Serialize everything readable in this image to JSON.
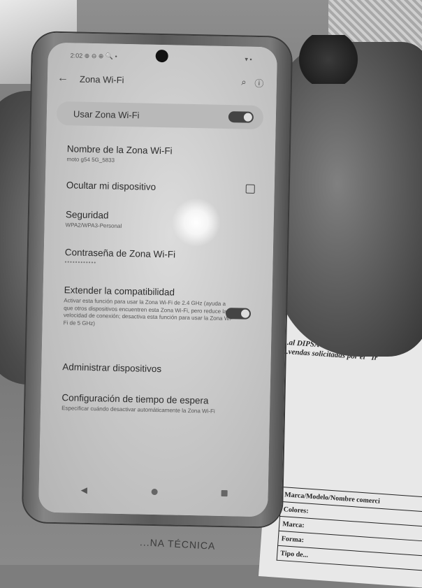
{
  "status_bar": {
    "time": "2:02",
    "indicators": "⊕ ⊖ ⊕ 🔍 •",
    "signal": "▾ ▪"
  },
  "header": {
    "title": "Zona Wi-Fi",
    "back_icon": "arrow-left-icon",
    "search_icon": "search-icon",
    "help_icon": "help-icon"
  },
  "master_switch": {
    "label": "Usar Zona Wi-Fi",
    "on": true
  },
  "settings": [
    {
      "title": "Nombre de la Zona Wi-Fi",
      "subtitle": "moto g54 5G_5833"
    },
    {
      "title": "Ocultar mi dispositivo",
      "checked": false
    },
    {
      "title": "Seguridad",
      "subtitle": "WPA2/WPA3-Personal"
    },
    {
      "title": "Contraseña de Zona Wi-Fi",
      "subtitle": "••••••••••••"
    },
    {
      "title": "Extender la compatibilidad",
      "subtitle": "Activar esta función para usar la Zona Wi-Fi de 2.4 GHz (ayuda a que otros dispositivos encuentren esta Zona Wi-Fi, pero reduce la velocidad de conexión; desactiva esta función para usar la Zona Wi-Fi de 5 GHz)",
      "on": true
    },
    {
      "title": "Administrar dispositivos"
    },
    {
      "title": "Configuración de tiempo de espera",
      "subtitle": "Especificar cuándo desactivar automáticamente la Zona Wi-Fi"
    }
  ],
  "nav": {
    "back": "◀",
    "home": "home-icon",
    "recents": "recents-icon"
  },
  "paper": {
    "text_line1": "...al DIPSA SA de CV, p",
    "text_line2": "...vendas solicitadas por el \"Ir",
    "table": [
      "Marca/Modelo/Nombre comerci",
      "Colores:",
      "Marca:",
      "Forma:",
      "Tipo de..."
    ],
    "footer": "...NA TÉCNICA"
  }
}
